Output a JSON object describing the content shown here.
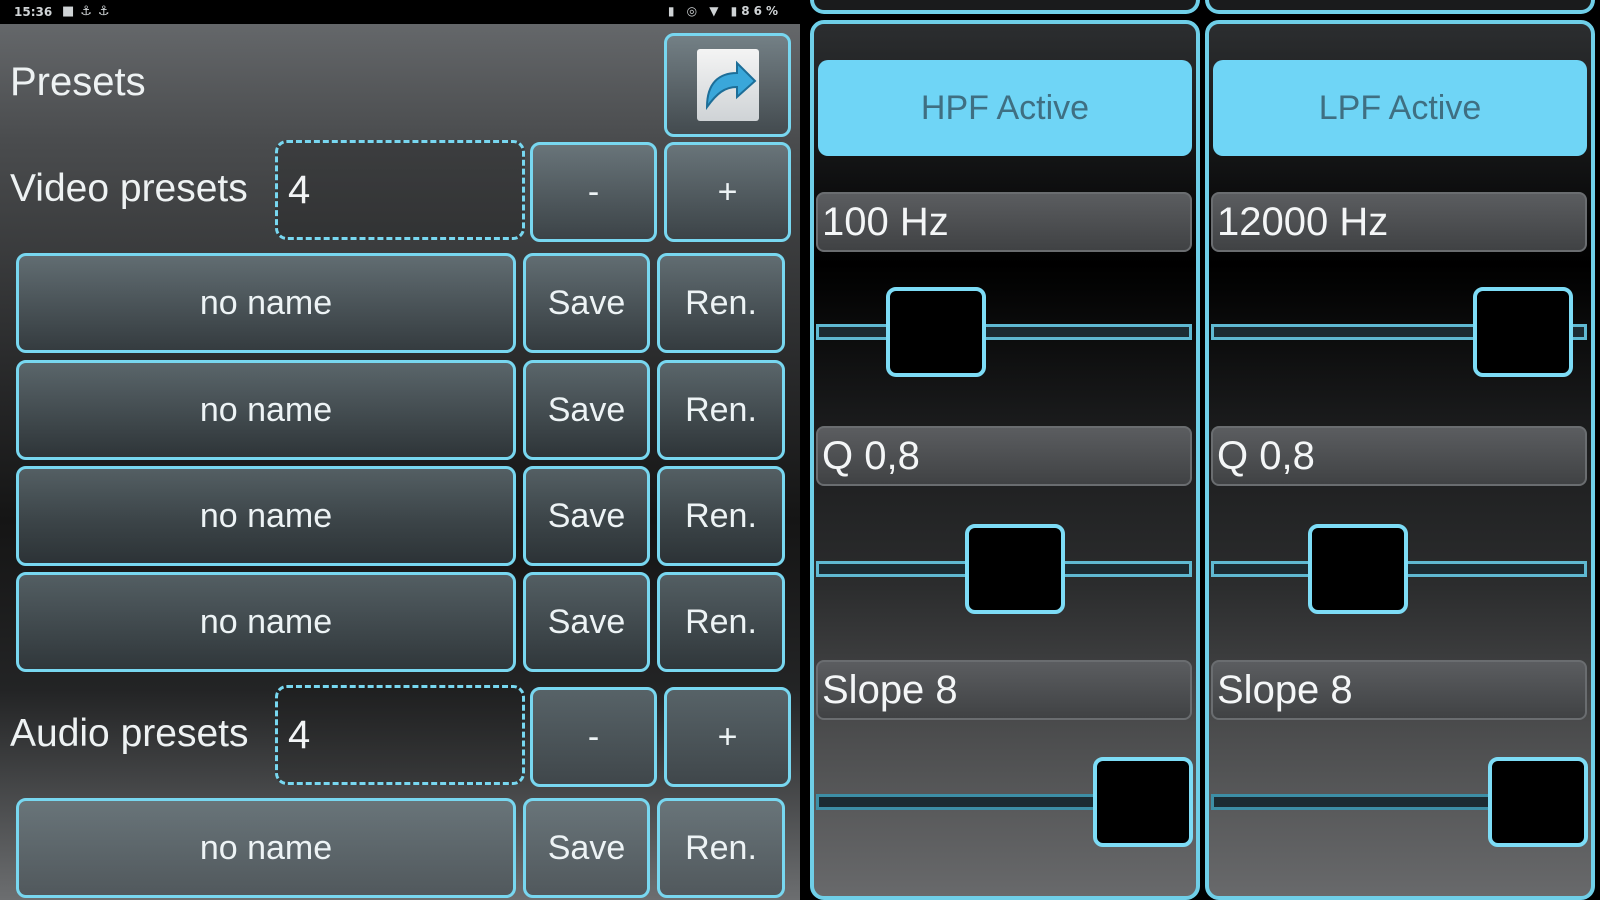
{
  "status_bar": {
    "time": "15:36",
    "battery": "86%"
  },
  "presets": {
    "title": "Presets",
    "video": {
      "label": "Video presets",
      "count": "4",
      "minus": "-",
      "plus": "+",
      "rows": [
        {
          "name": "no name",
          "save": "Save",
          "rename": "Ren."
        },
        {
          "name": "no name",
          "save": "Save",
          "rename": "Ren."
        },
        {
          "name": "no name",
          "save": "Save",
          "rename": "Ren."
        },
        {
          "name": "no name",
          "save": "Save",
          "rename": "Ren."
        }
      ]
    },
    "audio": {
      "label": "Audio presets",
      "count": "4",
      "minus": "-",
      "plus": "+",
      "rows": [
        {
          "name": "no name",
          "save": "Save",
          "rename": "Ren."
        }
      ]
    }
  },
  "filters": {
    "hpf": {
      "active_label": "HPF Active",
      "freq": "100 Hz",
      "q": "Q 0,8",
      "slope": "Slope 8",
      "freq_level": 0.32,
      "q_level": 0.53,
      "slope_level": 0.87
    },
    "lpf": {
      "active_label": "LPF Active",
      "freq": "12000 Hz",
      "q": "Q 0,8",
      "slope": "Slope 8",
      "freq_level": 0.83,
      "q_level": 0.39,
      "slope_level": 0.87
    }
  },
  "colors": {
    "accent": "#6fd5f6",
    "border": "#78d7f0"
  },
  "icons": {
    "share": "share-arrow-icon"
  }
}
